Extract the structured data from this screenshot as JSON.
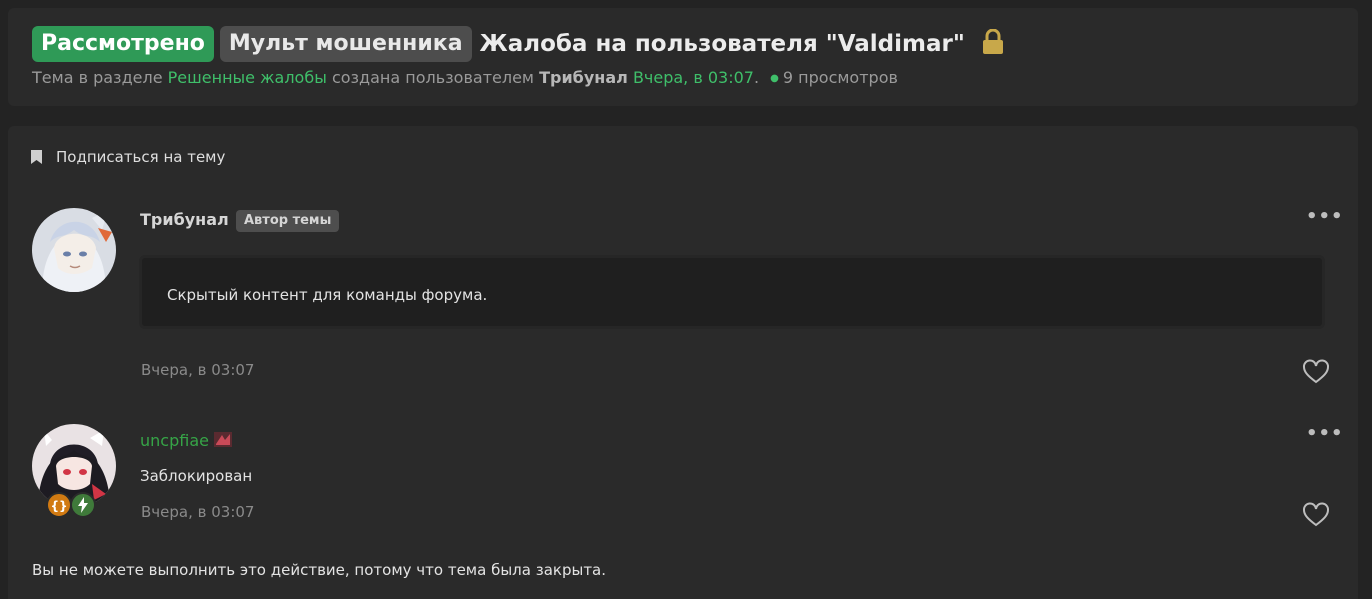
{
  "thread": {
    "prefixes": [
      "Рассмотрено",
      "Мульт мошенника"
    ],
    "title": "Жалоба на пользователя \"Valdimar\"",
    "meta": {
      "topic_in": "Тема в разделе",
      "section": "Решенные жалобы",
      "created_by": "создана пользователем",
      "author": "Трибунал",
      "date": "Вчера, в 03:07",
      "date_suffix": ".",
      "views": "9 просмотров"
    }
  },
  "subscribe_label": "Подписаться на тему",
  "posts": [
    {
      "author": "Трибунал",
      "author_color": "#a8a8a8",
      "badge": "Автор темы",
      "content": "Скрытый контент для команды форума.",
      "date": "Вчера, в 03:07"
    },
    {
      "author": "uncpfiae",
      "author_color": "#36a447",
      "content": "Заблокирован",
      "date": "Вчера, в 03:07"
    }
  ],
  "closed_message": "Вы не можете выполнить это действие, потому что тема была закрыта.",
  "icons": [
    "lock-icon",
    "bookmark-icon",
    "more-options-icon",
    "heart-icon",
    "code-badge-icon",
    "bolt-badge-icon"
  ],
  "colors": {
    "accent_green": "#2f9a57",
    "link_green": "#3fbf6a",
    "lock_gold": "#c8a84a"
  }
}
